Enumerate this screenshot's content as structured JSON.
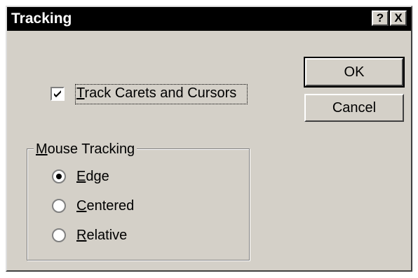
{
  "window": {
    "title": "Tracking",
    "help_label": "?",
    "close_label": "X"
  },
  "buttons": {
    "ok_label": "OK",
    "cancel_label": "Cancel"
  },
  "options": {
    "track_carets_label": "Track Carets and Cursors",
    "track_carets_checked": true
  },
  "mouse_tracking": {
    "group_label": "Mouse Tracking",
    "selected": "Edge",
    "items": [
      {
        "label": "Edge",
        "selected": true
      },
      {
        "label": "Centered",
        "selected": false
      },
      {
        "label": "Relative",
        "selected": false
      }
    ]
  }
}
